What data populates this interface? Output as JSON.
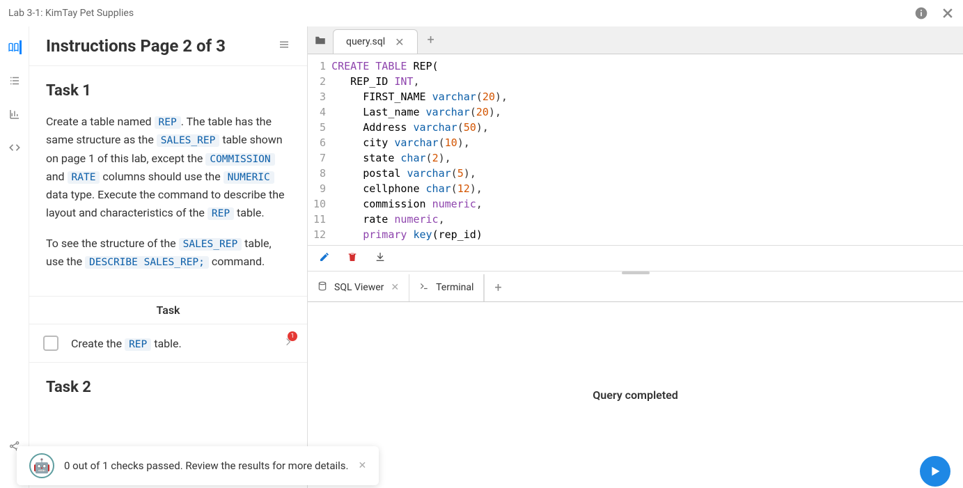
{
  "titlebar": {
    "title": "Lab 3-1: KimTay Pet Supplies"
  },
  "instructions": {
    "header": "Instructions Page 2 of 3",
    "task1_heading": "Task 1",
    "p1_a": "Create a table named ",
    "code_rep": "REP",
    "p1_b": ". The table has the same structure as the ",
    "code_salesrep": "SALES_REP",
    "p1_c": " table shown on page 1 of this lab, except the ",
    "code_commission": "COMMISSION",
    "p1_d": " and ",
    "code_rate": "RATE",
    "p1_e": " columns should use the ",
    "code_numeric": "NUMERIC",
    "p1_f": " data type. Execute the command to describe the layout and characteristics of the ",
    "p1_g": " table.",
    "p2_a": "To see the structure of the ",
    "p2_b": " table, use the ",
    "code_describe": "DESCRIBE SALES_REP;",
    "p2_c": " command.",
    "task_section": "Task",
    "task_row_a": "Create the ",
    "task_row_b": " table.",
    "task_badge": "1",
    "task2_heading": "Task 2"
  },
  "tabs": {
    "file": "query.sql"
  },
  "code": {
    "l1": {
      "a": "CREATE",
      "b": "TABLE",
      "c": "REP("
    },
    "l2": {
      "a": "REP_ID",
      "b": "INT",
      "c": ","
    },
    "l3": {
      "a": "FIRST_NAME",
      "b": "varchar",
      "c": "20"
    },
    "l4": {
      "a": "Last_name",
      "b": "varchar",
      "c": "20"
    },
    "l5": {
      "a": "Address",
      "b": "varchar",
      "c": "50"
    },
    "l6": {
      "a": "city",
      "b": "varchar",
      "c": "10"
    },
    "l7": {
      "a": "state",
      "b": "char",
      "c": "2"
    },
    "l8": {
      "a": "postal",
      "b": "varchar",
      "c": "5"
    },
    "l9": {
      "a": "cellphone",
      "b": "char",
      "c": "12"
    },
    "l10": {
      "a": "commission",
      "b": "numeric",
      "c": ","
    },
    "l11": {
      "a": "rate",
      "b": "numeric",
      "c": ","
    },
    "l12": {
      "a": "primary",
      "b": "key",
      "c": "(rep_id)"
    },
    "l13": ");"
  },
  "panels": {
    "sql": "SQL Viewer",
    "terminal": "Terminal",
    "result": "Query completed"
  },
  "toast": {
    "msg": "0 out of 1 checks passed. Review the results for more details."
  }
}
